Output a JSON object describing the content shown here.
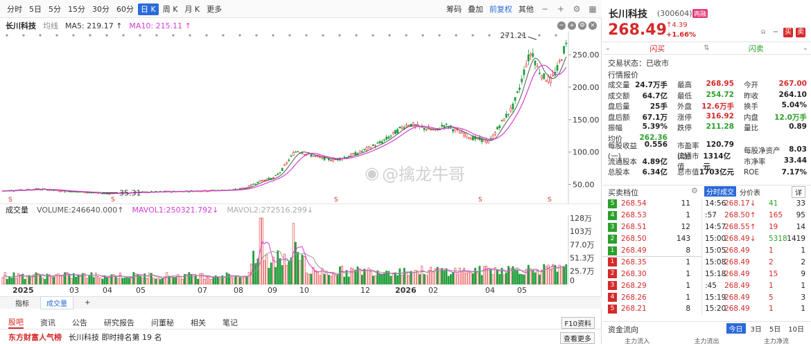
{
  "toolbar": {
    "periods": [
      "分时",
      "5日",
      "5分",
      "15分",
      "30分",
      "60分",
      "日 K",
      "周 K",
      "月 K",
      "更多"
    ],
    "active_period": "日 K",
    "tools": [
      "筹码",
      "叠加",
      "前复权",
      "其他"
    ]
  },
  "infoline": {
    "stock": "长川科技",
    "ma_type": "均线",
    "ma5": "MA5: 219.17 ↑",
    "ma10": "MA10: 215.11 ↑"
  },
  "kline": {
    "high_label": "271.21",
    "low_label": "35.31",
    "y_ticks": [
      "250.00",
      "200.00",
      "150.00",
      "100.00",
      "50.00"
    ]
  },
  "volume": {
    "title": "成交量",
    "volume": "VOLUME:246640.000↑",
    "mavol1": "MAVOL1:250321.792↓",
    "mavol2": "MAVOL2:272516.299↓",
    "y_ticks": [
      "128万",
      "103万",
      "77.0万",
      "51.3万",
      "25.7万",
      "0"
    ]
  },
  "x_axis": {
    "labels": [
      "2025",
      "03",
      "04",
      "05",
      "07",
      "08",
      "09",
      "10",
      "12",
      "2026",
      "02",
      "04",
      "05"
    ]
  },
  "bottom_tabs": [
    "指标",
    "成交量",
    "+"
  ],
  "news_tabs": [
    "股吧",
    "资讯",
    "公告",
    "研究报告",
    "问董秘",
    "相关",
    "笔记"
  ],
  "f10": "F10资料",
  "footer": {
    "logo": "东方财富人气榜",
    "text": "长川科技  即时排名第 19 名",
    "more": "查看更多"
  },
  "watermark": "@擒龙牛哥",
  "quote": {
    "name": "长川科技",
    "code": "(300604)",
    "badge": "两融",
    "price": "268.49",
    "change_abs": "↑4.39",
    "change_pct": "+1.66%",
    "flash_buy": "闪买",
    "flash_sell": "闪卖",
    "status": "交易状态：已收市",
    "section_title": "行情报价",
    "rows": [
      [
        [
          "成交量",
          "24.7万手",
          ""
        ],
        [
          "最高",
          "268.95",
          "red"
        ],
        [
          "今开",
          "267.00",
          "red"
        ]
      ],
      [
        [
          "成交额",
          "64.7亿",
          ""
        ],
        [
          "最低",
          "254.72",
          "green"
        ],
        [
          "昨收",
          "264.10",
          ""
        ]
      ],
      [
        [
          "盘后量",
          "25手",
          ""
        ],
        [
          "外盘",
          "12.6万手",
          "red"
        ],
        [
          "换手",
          "5.04%",
          ""
        ]
      ],
      [
        [
          "盘后额",
          "67.1万",
          ""
        ],
        [
          "涨停",
          "316.92",
          "red"
        ],
        [
          "内盘",
          "12.0万手",
          "green"
        ]
      ],
      [
        [
          "振幅",
          "5.39%",
          ""
        ],
        [
          "跌停",
          "211.28",
          "green"
        ],
        [
          "量比",
          "0.89",
          ""
        ]
      ],
      [
        [
          "均价",
          "262.36",
          "green"
        ],
        [
          "",
          "",
          ""
        ],
        [
          "",
          "",
          ""
        ]
      ]
    ],
    "fund_rows": [
      [
        [
          "每股收益(一)",
          "0.556",
          ""
        ],
        [
          "市盈率(动)",
          "120.79",
          ""
        ],
        [
          "每股净资产",
          "8.03",
          ""
        ]
      ],
      [
        [
          "流通股本",
          "4.89亿",
          ""
        ],
        [
          "流通市值",
          "1314亿元",
          ""
        ],
        [
          "市净率",
          "33.44",
          ""
        ]
      ],
      [
        [
          "总股本",
          "6.34亿",
          ""
        ],
        [
          "总市值",
          "1703亿元",
          ""
        ],
        [
          "ROE",
          "7.17%",
          ""
        ]
      ]
    ]
  },
  "book": {
    "title": "买卖档位",
    "tick_tab": "分时成交",
    "price_tab": "分价表",
    "detail": "详",
    "asks": [
      {
        "level": "5",
        "price": "268.54",
        "vol": "11"
      },
      {
        "level": "4",
        "price": "268.53",
        "vol": "1"
      },
      {
        "level": "3",
        "price": "268.51",
        "vol": "12"
      },
      {
        "level": "2",
        "price": "268.50",
        "vol": "143"
      },
      {
        "level": "1",
        "price": "268.49",
        "vol": "8"
      }
    ],
    "bids": [
      {
        "level": "1",
        "price": "268.35",
        "vol": "1"
      },
      {
        "level": "2",
        "price": "268.30",
        "vol": "1"
      },
      {
        "level": "3",
        "price": "268.29",
        "vol": "1"
      },
      {
        "level": "4",
        "price": "268.26",
        "vol": "1"
      },
      {
        "level": "5",
        "price": "268.21",
        "vol": "8"
      }
    ],
    "ticks": [
      {
        "time": "14:56",
        "price": "268.17↓",
        "count": "41",
        "dir": "green",
        "num": "33"
      },
      {
        "time": ":57",
        "price": "268.50↑",
        "count": "165",
        "dir": "red",
        "num": "95"
      },
      {
        "time": "14:57",
        "price": "268.55↑",
        "count": "19",
        "dir": "red",
        "num": "14"
      },
      {
        "time": "15:00",
        "price": "268.49↓",
        "count": "5318",
        "dir": "green",
        "num": "1419"
      },
      {
        "time": "15:05",
        "price": "268.49",
        "count": "1",
        "dir": "red",
        "num": "1"
      },
      {
        "time": "15:08",
        "price": "268.49",
        "count": "2",
        "dir": "red",
        "num": "2"
      },
      {
        "time": "15:18",
        "price": "268.49",
        "count": "15",
        "dir": "red",
        "num": "9"
      },
      {
        "time": ":45",
        "price": "268.49",
        "count": "1",
        "dir": "red",
        "num": "1"
      },
      {
        "time": "15:19",
        "price": "268.49",
        "count": "5",
        "dir": "red",
        "num": "3"
      },
      {
        "time": "15:20",
        "price": "268.49",
        "count": "1",
        "dir": "red",
        "num": "1"
      }
    ]
  },
  "flow": {
    "title": "资金流向",
    "tabs": [
      "今日",
      "3日",
      "5日",
      "10日"
    ],
    "sub": [
      "主力流入",
      "主力流出",
      "主力净流"
    ]
  },
  "chart_data": {
    "type": "candlestick",
    "title": "",
    "y_ticks": [
      50,
      100,
      150,
      200,
      250
    ],
    "high": 271.21,
    "low": 35.31,
    "volume_ticks_wan": [
      0,
      25.7,
      51.3,
      77.0,
      103,
      128
    ],
    "months": [
      "2025-01",
      "2025-03",
      "2025-04",
      "2025-05",
      "2025-07",
      "2025-08",
      "2025-09",
      "2025-10",
      "2025-12",
      "2026-01",
      "2026-02",
      "2026-04",
      "2026-05"
    ],
    "close_path": [
      [
        0,
        40
      ],
      [
        20,
        41
      ],
      [
        40,
        42
      ],
      [
        55,
        43
      ],
      [
        70,
        42
      ],
      [
        90,
        40
      ],
      [
        110,
        39
      ],
      [
        125,
        38
      ],
      [
        140,
        37
      ],
      [
        155,
        36
      ],
      [
        165,
        36.5
      ],
      [
        180,
        37
      ],
      [
        200,
        38
      ],
      [
        220,
        38.5
      ],
      [
        240,
        39
      ],
      [
        260,
        39.5
      ],
      [
        280,
        40
      ],
      [
        300,
        40.5
      ],
      [
        320,
        41
      ],
      [
        340,
        42
      ],
      [
        355,
        45
      ],
      [
        365,
        50
      ],
      [
        375,
        55
      ],
      [
        385,
        58
      ],
      [
        395,
        60
      ],
      [
        405,
        70
      ],
      [
        415,
        85
      ],
      [
        425,
        100
      ],
      [
        430,
        102
      ],
      [
        440,
        98
      ],
      [
        450,
        95
      ],
      [
        460,
        92
      ],
      [
        470,
        90
      ],
      [
        480,
        88
      ],
      [
        490,
        90
      ],
      [
        500,
        93
      ],
      [
        510,
        96
      ],
      [
        520,
        100
      ],
      [
        530,
        105
      ],
      [
        540,
        110
      ],
      [
        550,
        115
      ],
      [
        560,
        122
      ],
      [
        570,
        130
      ],
      [
        580,
        138
      ],
      [
        590,
        143
      ],
      [
        600,
        140
      ],
      [
        610,
        137
      ],
      [
        620,
        135
      ],
      [
        630,
        133
      ],
      [
        640,
        142
      ],
      [
        650,
        138
      ],
      [
        660,
        132
      ],
      [
        670,
        128
      ],
      [
        680,
        122
      ],
      [
        690,
        120
      ],
      [
        700,
        118
      ],
      [
        705,
        115
      ],
      [
        712,
        125
      ],
      [
        720,
        140
      ],
      [
        730,
        155
      ],
      [
        740,
        170
      ],
      [
        750,
        200
      ],
      [
        760,
        240
      ],
      [
        768,
        255
      ],
      [
        775,
        230
      ],
      [
        785,
        215
      ],
      [
        795,
        210
      ],
      [
        805,
        230
      ],
      [
        815,
        262
      ],
      [
        820,
        268.49
      ]
    ]
  }
}
